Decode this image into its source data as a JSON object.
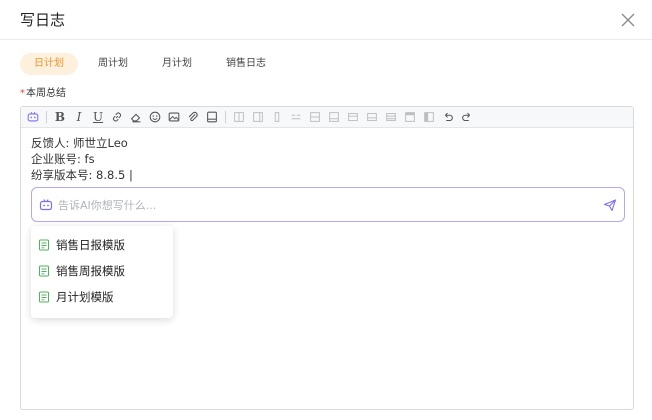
{
  "dialog": {
    "title": "写日志"
  },
  "tabs": [
    {
      "label": "日计划",
      "active": true
    },
    {
      "label": "周计划",
      "active": false
    },
    {
      "label": "月计划",
      "active": false
    },
    {
      "label": "销售日志",
      "active": false
    }
  ],
  "section": {
    "required_mark": "*",
    "label": "本周总结"
  },
  "toolbar": {
    "items": [
      "ai-icon",
      "bold",
      "italic",
      "underline",
      "link-icon",
      "eraser-icon",
      "emoji-icon",
      "image-icon",
      "attachment-icon",
      "template-icon",
      "table-col-icon",
      "table-row-icon",
      "merge-icon",
      "split-icon",
      "table-icons",
      "undo-icon",
      "redo-icon"
    ],
    "bold_label": "B",
    "italic_label": "I",
    "underline_label": "U"
  },
  "editor": {
    "lines": [
      "反馈人: 师世立Leo",
      "企业账号: fs",
      "纷享版本号: 8.8.5 |"
    ]
  },
  "ai": {
    "placeholder": "告诉AI你想写什么..."
  },
  "templates": [
    {
      "label": "销售日报模版"
    },
    {
      "label": "销售周报模版"
    },
    {
      "label": "月计划模版"
    }
  ],
  "colors": {
    "accent": "#f0942b",
    "tab_active_bg": "#fdf0dc",
    "ai_border": "#b9a7ec",
    "ai_icon": "#7b6ef6",
    "template_icon": "#52b25c",
    "required": "#f0493e"
  }
}
